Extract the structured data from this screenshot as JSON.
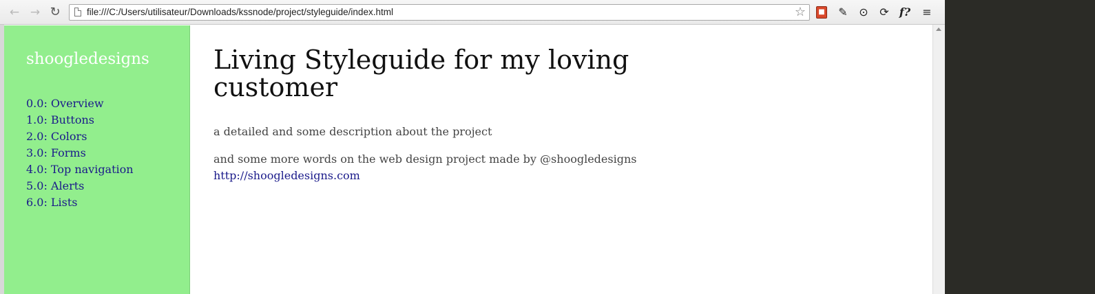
{
  "browser": {
    "address_bar": {
      "url": "file:///C:/Users/utilisateur/Downloads/kssnode/project/styleguide/index.html"
    },
    "nav": {
      "back_icon": "←",
      "forward_icon": "→",
      "reload_icon": "↻"
    },
    "bookmark_icon": "☆",
    "extensions": {
      "ext1_icon": "■",
      "ext2_icon": "✎",
      "ext3_icon": "⊙",
      "ext4_icon": "⟳",
      "ext5_label": "f?",
      "menu_icon": "≡"
    }
  },
  "sidebar": {
    "brand": "shoogledesigns",
    "items": [
      {
        "label": "0.0: Overview"
      },
      {
        "label": "1.0: Buttons"
      },
      {
        "label": "2.0: Colors"
      },
      {
        "label": "3.0: Forms"
      },
      {
        "label": "4.0: Top navigation"
      },
      {
        "label": "5.0: Alerts"
      },
      {
        "label": "6.0: Lists"
      }
    ]
  },
  "main": {
    "title": "Living Styleguide for my loving customer",
    "description": "a detailed and some description about the project",
    "more_words": "and some more words on the web design project made by @shoogledesigns",
    "link": "http://shoogledesigns.com"
  },
  "colors": {
    "sidebar_bg": "#92ee8d",
    "link": "#1a1a8a",
    "brand": "#ffffff"
  }
}
